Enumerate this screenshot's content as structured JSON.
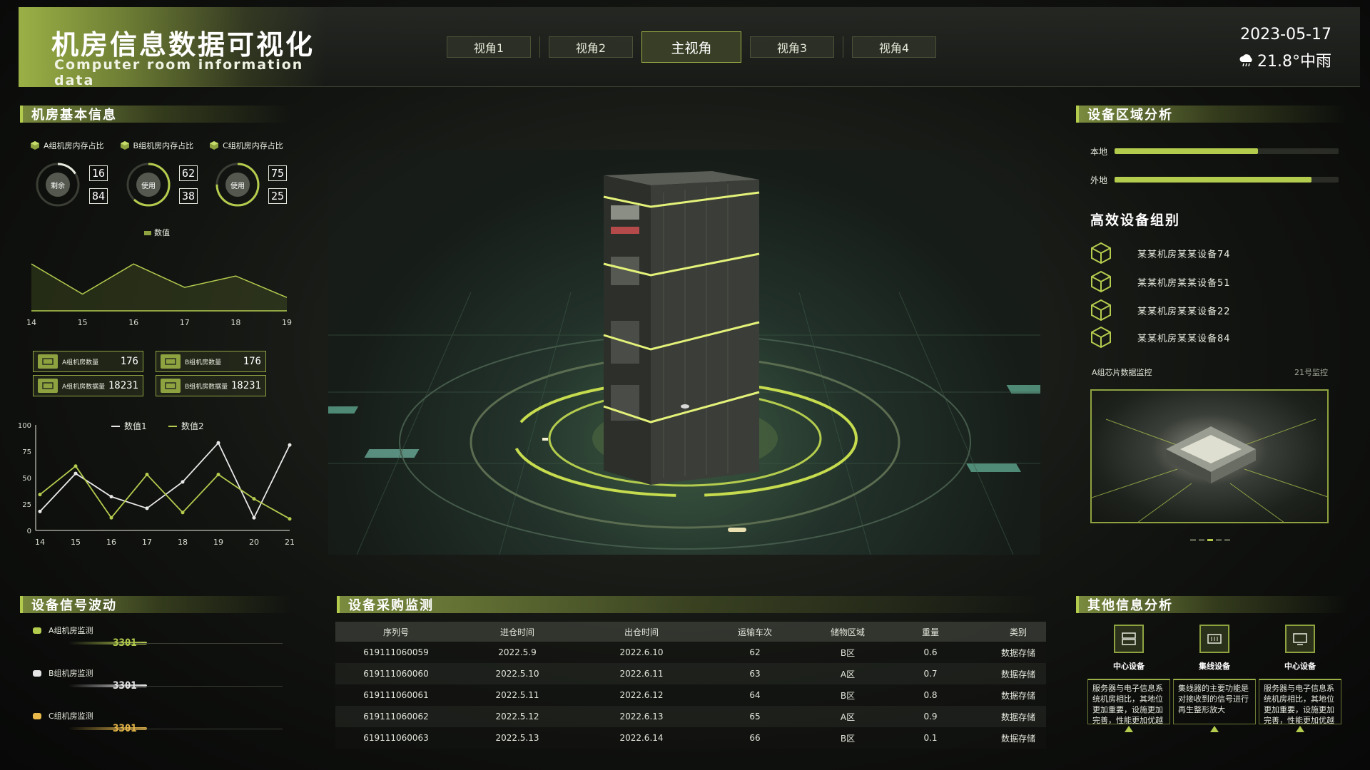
{
  "header": {
    "title_cn": "机房信息数据可视化",
    "title_en": "Computer room information data",
    "tabs": [
      "视角1",
      "视角2",
      "主视角",
      "视角3",
      "视角4"
    ],
    "active_tab": "主视角",
    "date": "2023-05-17",
    "weather": "21.8°中雨",
    "weather_icon": "cloud-rain-icon"
  },
  "left": {
    "basic_title": "机房基本信息",
    "rings": [
      {
        "legend": "A组机房内存占比",
        "center": "剩余",
        "top": "16",
        "bottom": "84",
        "percent": 16
      },
      {
        "legend": "B组机房内存占比",
        "center": "使用",
        "top": "62",
        "bottom": "38",
        "percent": 62
      },
      {
        "legend": "C组机房内存占比",
        "center": "使用",
        "top": "75",
        "bottom": "25",
        "percent": 75
      }
    ],
    "stats": [
      {
        "label": "A组机房数量",
        "value": "176"
      },
      {
        "label": "B组机房数量",
        "value": "176"
      },
      {
        "label": "A组机房数据量",
        "value": "18231"
      },
      {
        "label": "B组机房数据量",
        "value": "18231"
      }
    ],
    "signal_title": "设备信号波动",
    "signals": [
      {
        "label": "A组机房监测",
        "value": "3301",
        "color": "#b4cc4e"
      },
      {
        "label": "B组机房监测",
        "value": "3301",
        "color": "#e6e6e6"
      },
      {
        "label": "C组机房监测",
        "value": "3301",
        "color": "#e8b84a"
      }
    ]
  },
  "chart_data": [
    {
      "type": "area",
      "series": [
        {
          "name": "数值",
          "values": [
            70,
            25,
            70,
            35,
            52,
            20
          ]
        }
      ],
      "x": [
        "14",
        "15",
        "16",
        "17",
        "18",
        "19"
      ],
      "ylim": [
        0,
        100
      ],
      "legend_position": "top",
      "color": "#b4cc4e"
    },
    {
      "type": "line",
      "x": [
        "14",
        "15",
        "16",
        "17",
        "18",
        "19",
        "20",
        "21"
      ],
      "series": [
        {
          "name": "数值1",
          "values": [
            18,
            54,
            32,
            21,
            46,
            83,
            12,
            81
          ],
          "color": "#e8e8e8"
        },
        {
          "name": "数值2",
          "values": [
            34,
            61,
            12,
            53,
            17,
            53,
            30,
            11
          ],
          "color": "#b4cc4e"
        }
      ],
      "yticks": [
        "0",
        "25",
        "50",
        "75",
        "100"
      ],
      "ylim": [
        0,
        100
      ],
      "legend_position": "top"
    }
  ],
  "center": {
    "table_title": "设备采购监测",
    "columns": [
      "序列号",
      "进仓时间",
      "出仓时间",
      "运输车次",
      "储物区域",
      "重量",
      "类别"
    ],
    "rows": [
      [
        "619111060059",
        "2022.5.9",
        "2022.6.10",
        "62",
        "B区",
        "0.6",
        "数据存储"
      ],
      [
        "619111060060",
        "2022.5.10",
        "2022.6.11",
        "63",
        "A区",
        "0.7",
        "数据存储"
      ],
      [
        "619111060061",
        "2022.5.11",
        "2022.6.12",
        "64",
        "B区",
        "0.8",
        "数据存储"
      ],
      [
        "619111060062",
        "2022.5.12",
        "2022.6.13",
        "65",
        "A区",
        "0.9",
        "数据存储"
      ],
      [
        "619111060063",
        "2022.5.13",
        "2022.6.14",
        "66",
        "B区",
        "0.1",
        "数据存储"
      ]
    ]
  },
  "right": {
    "region_title": "设备区域分析",
    "regions": [
      {
        "label": "本地",
        "fill": 0.64
      },
      {
        "label": "外地",
        "fill": 0.88
      }
    ],
    "group_title": "高效设备组别",
    "groups": [
      "某某机房某某设备74",
      "某某机房某某设备51",
      "某某机房某某设备22",
      "某某机房某某设备84"
    ],
    "chip_left": "A组芯片数据监控",
    "chip_right": "21号监控",
    "other_title": "其他信息分析",
    "others": [
      {
        "name": "中心设备",
        "desc": "服务器与电子信息系统机房相比，其地位更加重要，设施更加完善，性能更加优越",
        "icon": "server-icon"
      },
      {
        "name": "集线设备",
        "desc": "集线器的主要功能是对接收到的信号进行再生整形放大",
        "icon": "hub-icon"
      },
      {
        "name": "中心设备",
        "desc": "服务器与电子信息系统机房相比，其地位更加重要，设施更加完善，性能更加优越",
        "icon": "monitor-icon"
      }
    ]
  }
}
